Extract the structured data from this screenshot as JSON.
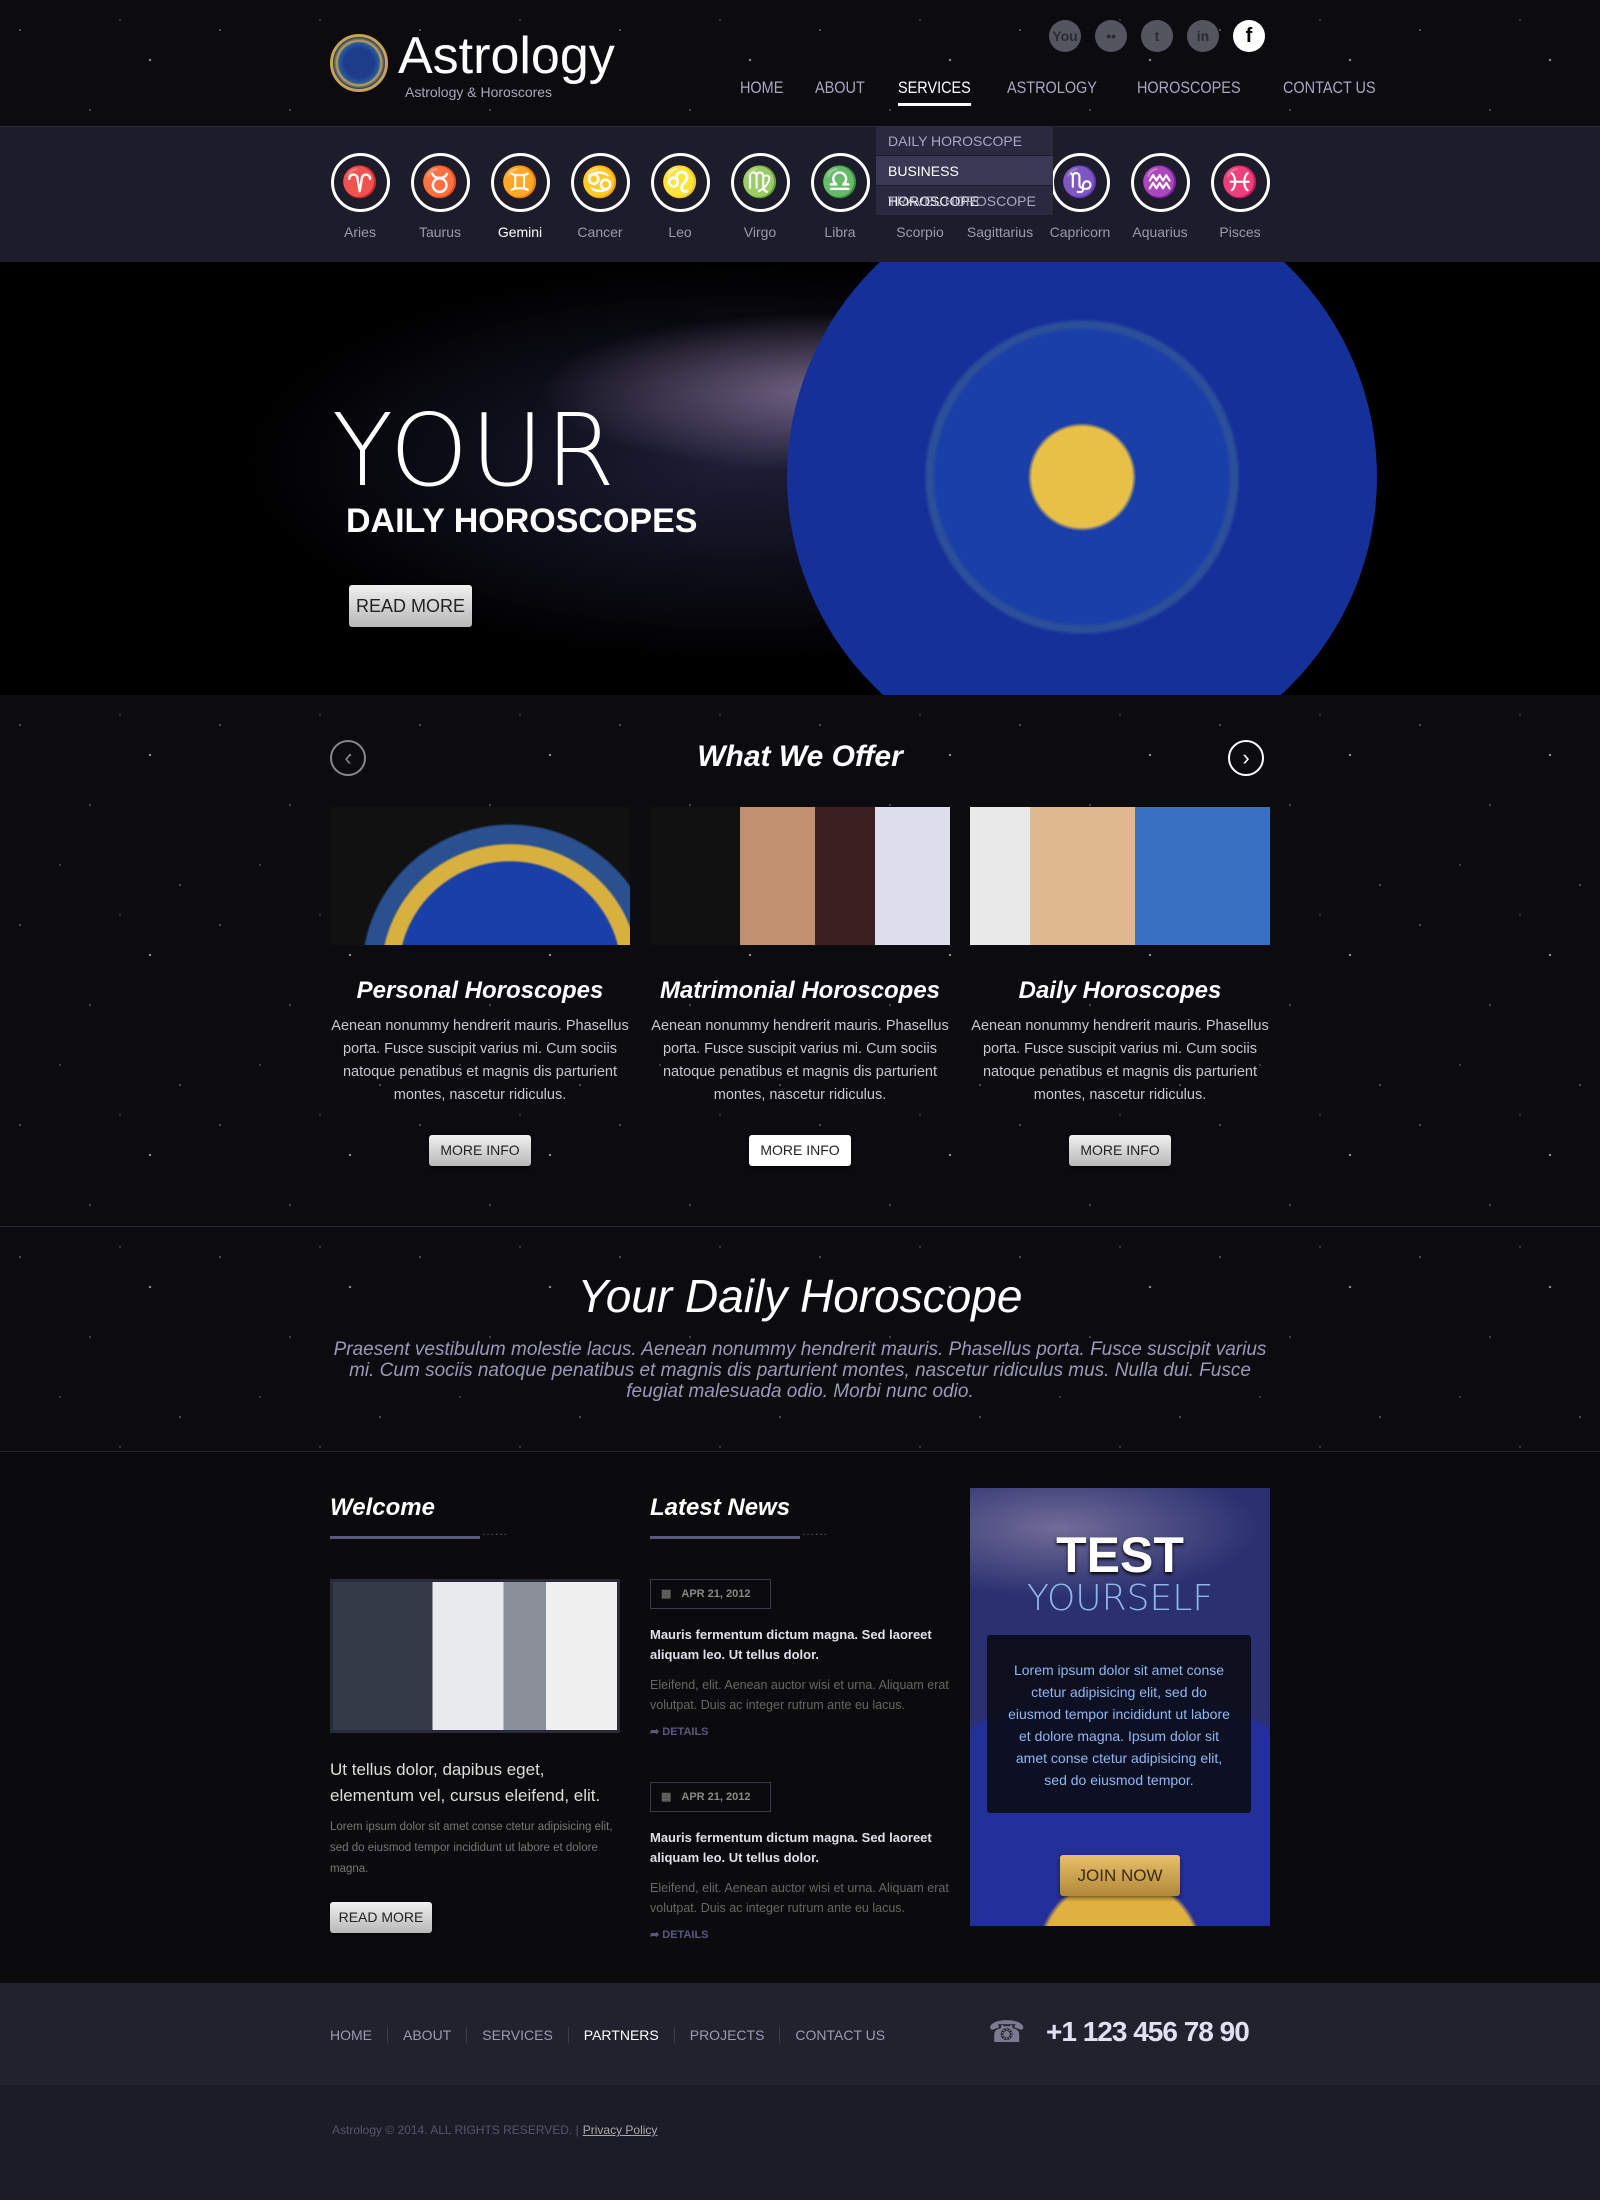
{
  "header": {
    "logo_title": "Astrology",
    "logo_subtitle": "Astrology & Horoscores",
    "social": [
      {
        "icon": "youtube-icon",
        "glyph": "You"
      },
      {
        "icon": "flickr-icon",
        "glyph": "••"
      },
      {
        "icon": "twitter-icon",
        "glyph": "t"
      },
      {
        "icon": "linkedin-icon",
        "glyph": "in"
      },
      {
        "icon": "facebook-icon",
        "glyph": "f"
      }
    ],
    "nav": [
      "HOME",
      "ABOUT",
      "SERVICES",
      "ASTROLOGY",
      "HOROSCOPES",
      "CONTACT US"
    ],
    "active_nav": "SERVICES",
    "dropdown": [
      "DAILY HOROSCOPE",
      "BUSINESS HOROSCOPE",
      "TRAVEL HOROSCOPE"
    ],
    "active_dropdown": "BUSINESS HOROSCOPE"
  },
  "zodiac": [
    {
      "name": "Aries",
      "glyph": "♈"
    },
    {
      "name": "Taurus",
      "glyph": "♉"
    },
    {
      "name": "Gemini",
      "glyph": "♊"
    },
    {
      "name": "Cancer",
      "glyph": "♋"
    },
    {
      "name": "Leo",
      "glyph": "♌"
    },
    {
      "name": "Virgo",
      "glyph": "♍"
    },
    {
      "name": "Libra",
      "glyph": "♎"
    },
    {
      "name": "Scorpio",
      "glyph": "♏"
    },
    {
      "name": "Sagittarius",
      "glyph": "♐"
    },
    {
      "name": "Capricorn",
      "glyph": "♑"
    },
    {
      "name": "Aquarius",
      "glyph": "♒"
    },
    {
      "name": "Pisces",
      "glyph": "♓"
    }
  ],
  "zodiac_active": "Gemini",
  "hero": {
    "line1": "YOUR",
    "line2": "DAILY HOROSCOPES",
    "button": "READ MORE"
  },
  "offer": {
    "title": "What We Offer",
    "prev": "‹",
    "next": "›",
    "cards": [
      {
        "title": "Personal Horoscopes",
        "text": "Aenean nonummy hendrerit mauris. Phasellus porta. Fusce suscipit varius mi. Cum sociis natoque penatibus et magnis dis parturient montes, nascetur ridiculus.",
        "button": "MORE INFO"
      },
      {
        "title": "Matrimonial Horoscopes",
        "text": "Aenean nonummy hendrerit mauris. Phasellus porta. Fusce suscipit varius mi. Cum sociis natoque penatibus et magnis dis parturient montes, nascetur ridiculus.",
        "button": "MORE INFO"
      },
      {
        "title": "Daily Horoscopes",
        "text": "Aenean nonummy hendrerit mauris. Phasellus porta. Fusce suscipit varius mi. Cum sociis natoque penatibus et magnis dis parturient montes, nascetur ridiculus.",
        "button": "MORE INFO"
      }
    ]
  },
  "daily": {
    "title": "Your Daily Horoscope",
    "text": "Praesent vestibulum molestie lacus. Aenean nonummy hendrerit mauris. Phasellus porta. Fusce suscipit varius mi. Cum sociis natoque penatibus et magnis dis parturient montes, nascetur ridiculus mus. Nulla dui. Fusce feugiat malesuada odio. Morbi nunc odio."
  },
  "welcome": {
    "title": "Welcome",
    "lead": "Ut tellus dolor, dapibus eget, elementum vel, cursus eleifend, elit.",
    "body": "Lorem ipsum dolor sit amet conse ctetur adipisicing elit, sed do eiusmod tempor incididunt ut labore et dolore magna.",
    "button": "READ MORE"
  },
  "news": {
    "title": "Latest News",
    "items": [
      {
        "date": "APR 21, 2012",
        "title": "Mauris fermentum dictum magna. Sed laoreet aliquam leo. Ut tellus dolor.",
        "body": "Eleifend, elit. Aenean auctor wisi et urna. Aliquam erat volutpat. Duis ac integer rutrum ante eu lacus.",
        "link": "DETAILS"
      },
      {
        "date": "APR 21, 2012",
        "title": "Mauris fermentum dictum magna. Sed laoreet aliquam leo. Ut tellus dolor.",
        "body": "Eleifend, elit. Aenean auctor wisi et urna. Aliquam erat volutpat. Duis ac integer rutrum ante eu lacus.",
        "link": "DETAILS"
      }
    ]
  },
  "test": {
    "line1": "TEST",
    "line2": "YOURSELF",
    "text": "Lorem ipsum dolor sit amet conse ctetur adipisicing elit, sed do eiusmod tempor incididunt ut labore et dolore magna. Ipsum dolor sit amet conse ctetur adipisicing elit, sed do eiusmod tempor.",
    "button": "JOIN NOW"
  },
  "footer": {
    "nav": [
      "HOME",
      "ABOUT",
      "SERVICES",
      "PARTNERS",
      "PROJECTS",
      "CONTACT US"
    ],
    "active_nav": "PARTNERS",
    "phone": "+1 123 456 78 90",
    "copyright": "Astrology  © 2014. ALL RIGHTS RESERVED.  |",
    "privacy": "Privacy Policy"
  },
  "colors": {
    "accent": "#5a5880",
    "zodiac_bar": "#1d1c2a",
    "footer": "#1c1c28",
    "test_text": "#8fb8f0",
    "join_gold": "#d0a850"
  }
}
